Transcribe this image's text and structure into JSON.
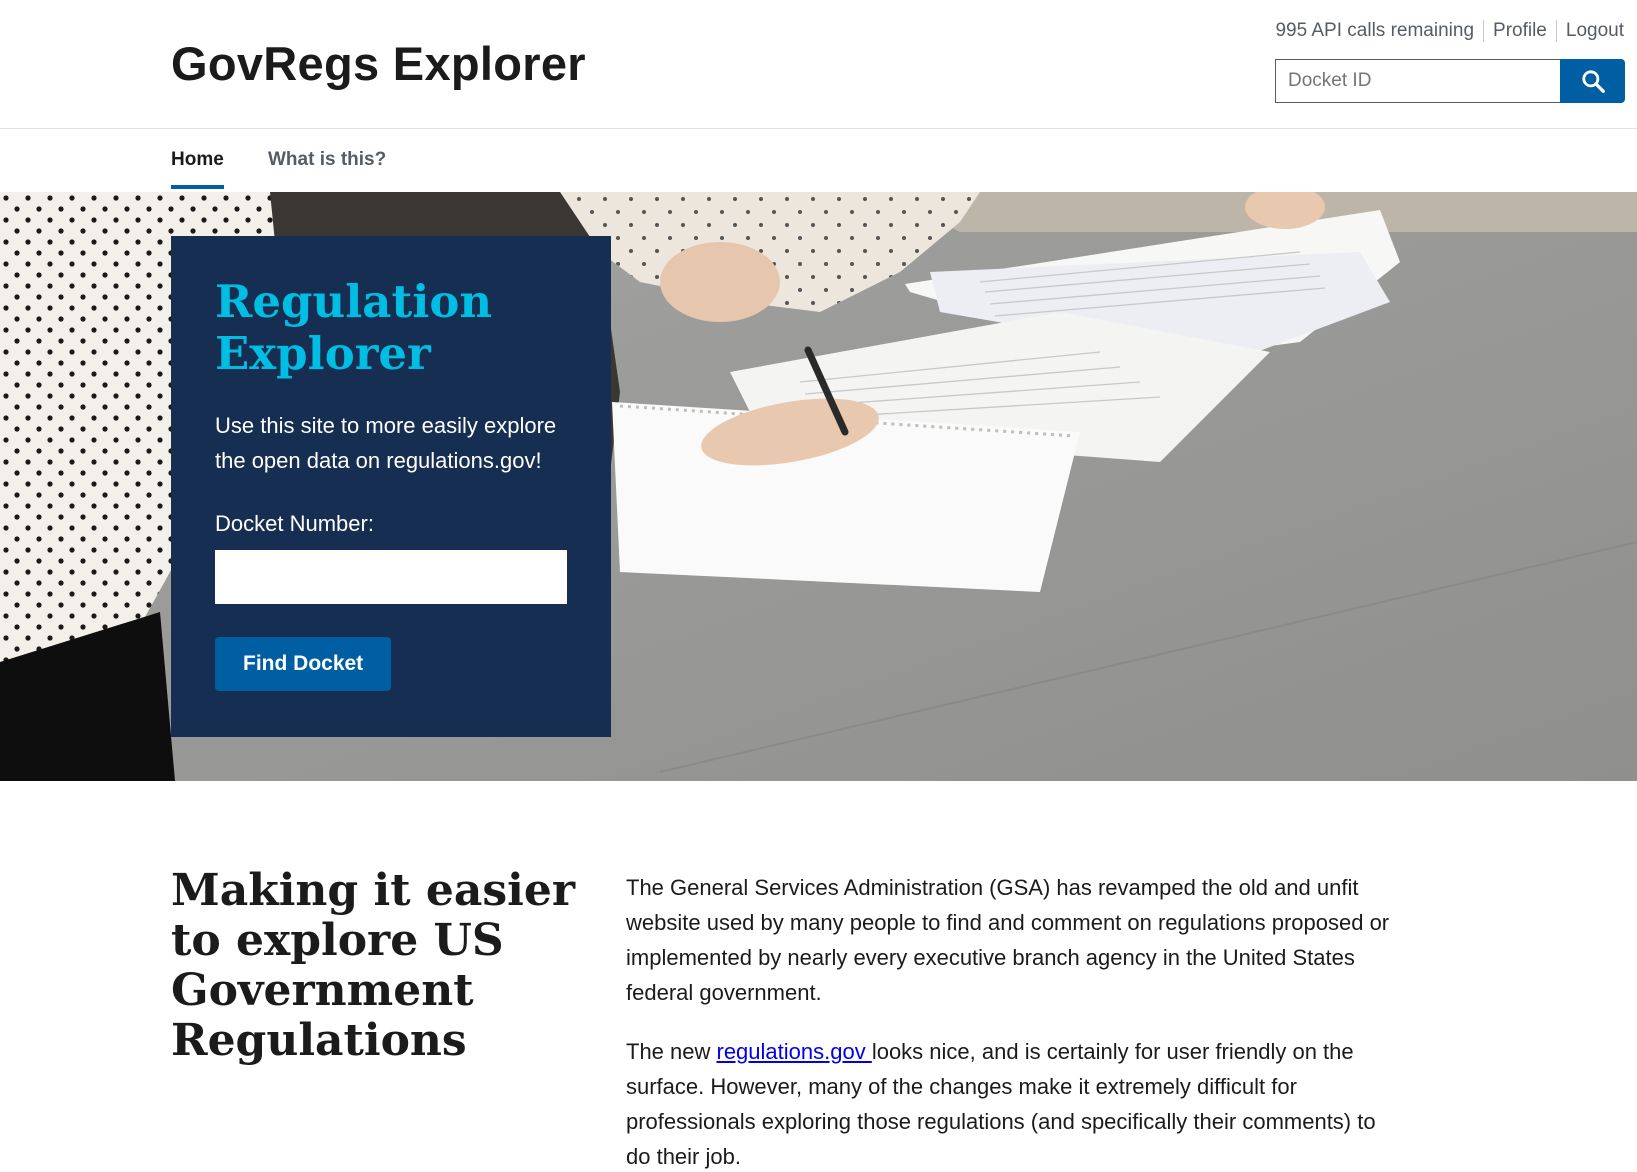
{
  "header": {
    "site_title": "GovRegs Explorer",
    "api_calls": "995 API calls remaining",
    "profile_label": "Profile",
    "logout_label": "Logout",
    "search_placeholder": "Docket ID",
    "search_icon": "search-icon"
  },
  "nav": {
    "items": [
      {
        "label": "Home",
        "active": true
      },
      {
        "label": "What is this?",
        "active": false
      }
    ]
  },
  "hero": {
    "title": "Regulation Explorer",
    "title_line1": "Regulation",
    "title_line2": "Explorer",
    "description": "Use this site to more easily explore the open data on regulations.gov!",
    "docket_label": "Docket Number:",
    "docket_value": "",
    "button_label": "Find Docket"
  },
  "intro": {
    "heading": "Making it easier to explore US Government Regulations",
    "paragraph1": "The General Services Administration (GSA) has revamped the old and unfit website used by many people to find and comment on regulations proposed or implemented by nearly every executive branch agency in the United States federal government.",
    "paragraph2_before": "The new ",
    "paragraph2_link": "regulations.gov ",
    "paragraph2_after": "looks nice, and is certainly for user friendly on the surface. However, many of the changes make it extremely difficult for professionals exploring those regulations (and specifically their comments) to do their job."
  },
  "colors": {
    "primary": "#005ea2",
    "callout_bg": "#162e51",
    "callout_title": "#00bde3",
    "text": "#1b1b1b",
    "muted": "#565c65"
  }
}
